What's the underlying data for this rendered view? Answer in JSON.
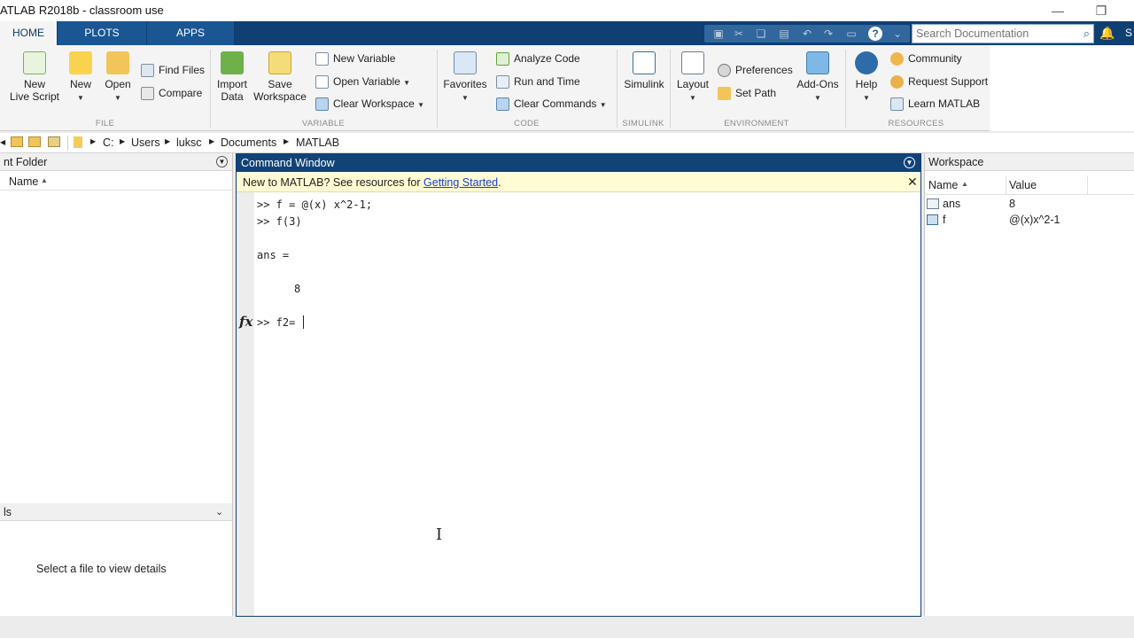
{
  "window": {
    "title": "ATLAB R2018b - classroom use",
    "minimize_glyph": "—",
    "restore_glyph": "❐"
  },
  "tabs": [
    {
      "label": "HOME",
      "active": true
    },
    {
      "label": "PLOTS",
      "active": false
    },
    {
      "label": "APPS",
      "active": false
    }
  ],
  "search": {
    "placeholder": "Search Documentation",
    "icon": "search-icon"
  },
  "user_initial": "S",
  "ribbon": {
    "file": {
      "group_label": "FILE",
      "new_live_script": "New\nLive Script",
      "new": "New",
      "open": "Open",
      "find_files": "Find Files",
      "compare": "Compare"
    },
    "variable": {
      "group_label": "VARIABLE",
      "import_data": "Import\nData",
      "save_workspace": "Save\nWorkspace",
      "new_variable": "New Variable",
      "open_variable": "Open Variable",
      "clear_workspace": "Clear Workspace"
    },
    "code": {
      "group_label": "CODE",
      "favorites": "Favorites",
      "analyze_code": "Analyze Code",
      "run_and_time": "Run and Time",
      "clear_commands": "Clear Commands"
    },
    "simulink": {
      "group_label": "SIMULINK",
      "simulink": "Simulink"
    },
    "environment": {
      "group_label": "ENVIRONMENT",
      "layout": "Layout",
      "preferences": "Preferences",
      "set_path": "Set Path",
      "add_ons": "Add-Ons"
    },
    "resources": {
      "group_label": "RESOURCES",
      "help": "Help",
      "community": "Community",
      "request_support": "Request Support",
      "learn_matlab": "Learn MATLAB"
    }
  },
  "address": {
    "path": [
      "C:",
      "Users",
      "luksc",
      "Documents",
      "MATLAB"
    ]
  },
  "current_folder": {
    "title": "nt Folder",
    "column_name": "Name",
    "details_title": "ls",
    "details_text": "Select a file to view details"
  },
  "command_window": {
    "title": "Command Window",
    "banner_text": "New to MATLAB? See resources for ",
    "banner_link": "Getting Started",
    "banner_period": ".",
    "lines": [
      ">> f = @(x) x^2-1;",
      ">> f(3)",
      "ans =",
      "8"
    ],
    "prompt_symbol": "fx",
    "current_input": ">> f2="
  },
  "workspace": {
    "title": "Workspace",
    "col_name": "Name",
    "col_value": "Value",
    "rows": [
      {
        "name": "ans",
        "value": "8"
      },
      {
        "name": "f",
        "value": "@(x)x^2-1"
      }
    ]
  },
  "colors": {
    "tab_bar": "#0f3f73",
    "ribbon": "#f4f4f4",
    "cmd_header": "#114377",
    "banner": "#fffbd2",
    "link": "#1a3fd1"
  }
}
